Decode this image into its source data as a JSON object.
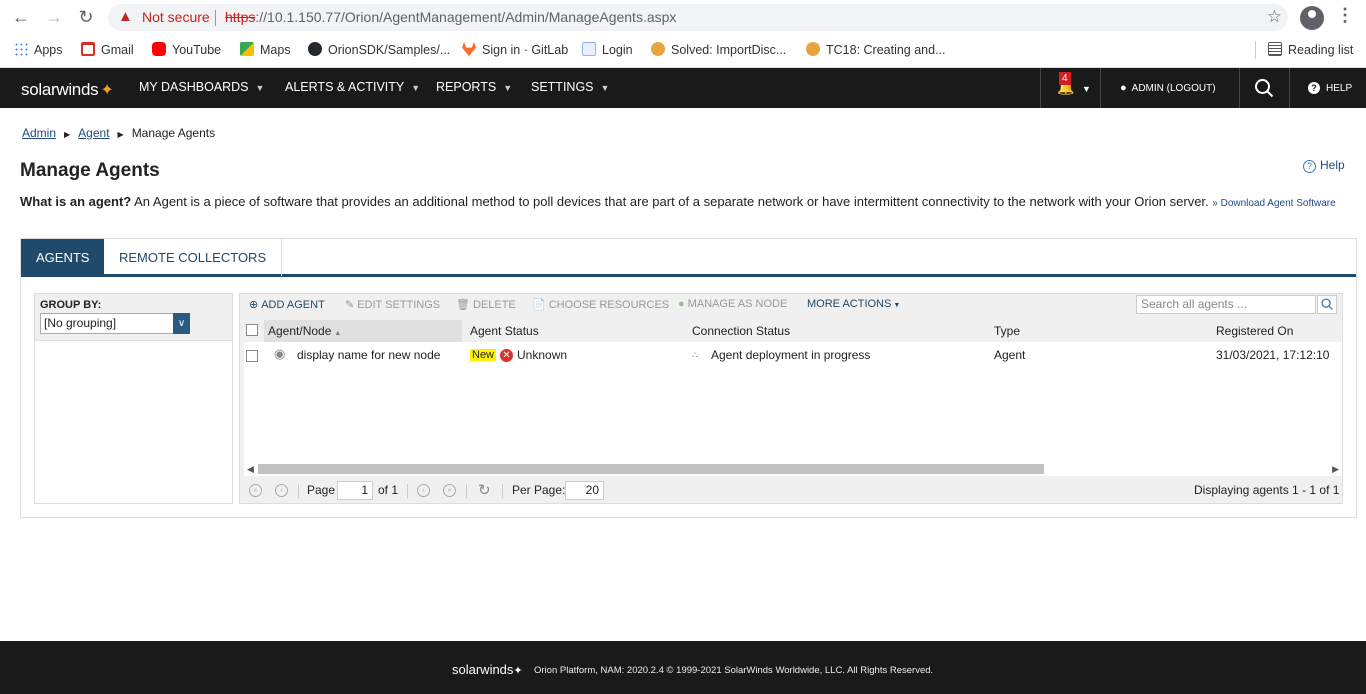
{
  "browser": {
    "not_secure": "Not secure",
    "url_scheme": "https",
    "url_rest": "://10.1.150.77/Orion/AgentManagement/Admin/ManageAgents.aspx",
    "bookmarks": [
      {
        "label": "Apps",
        "icon": "apps-icon",
        "color": "#4285f4"
      },
      {
        "label": "Gmail",
        "icon": "gmail-icon",
        "color": "#d93025"
      },
      {
        "label": "YouTube",
        "icon": "youtube-icon",
        "color": "#ff0000"
      },
      {
        "label": "Maps",
        "icon": "maps-icon",
        "color": "#34a853"
      },
      {
        "label": "OrionSDK/Samples/...",
        "icon": "github-icon",
        "color": "#24292e"
      },
      {
        "label": "Sign in · GitLab",
        "icon": "gitlab-icon",
        "color": "#fc6d26"
      },
      {
        "label": "Login",
        "icon": "page-icon",
        "color": "#8ab4f8"
      },
      {
        "label": "Solved: ImportDisc...",
        "icon": "thwack-icon",
        "color": "#e8a33d"
      },
      {
        "label": "TC18: Creating and...",
        "icon": "thwack-icon",
        "color": "#e8a33d"
      }
    ],
    "reading_list": "Reading list"
  },
  "header": {
    "logo": "solarwinds",
    "menus": [
      "MY DASHBOARDS",
      "ALERTS & ACTIVITY",
      "REPORTS",
      "SETTINGS"
    ],
    "notifications": "4",
    "user": "ADMIN (LOGOUT)",
    "help": "HELP"
  },
  "breadcrumb": {
    "admin": "Admin",
    "agent": "Agent",
    "current": "Manage Agents"
  },
  "page": {
    "title": "Manage Agents",
    "help": "Help",
    "desc_bold": "What is an agent?",
    "desc_text": " An Agent is a piece of software that provides an additional method to poll devices that are part of a separate network or have intermittent connectivity to the network with your Orion server. ",
    "download_link": "» Download Agent Software"
  },
  "tabs": {
    "agents": "AGENTS",
    "remote": "REMOTE COLLECTORS"
  },
  "groupby": {
    "label": "GROUP BY:",
    "value": "[No grouping]"
  },
  "toolbar": {
    "add": "ADD AGENT",
    "edit": "EDIT SETTINGS",
    "delete": "DELETE",
    "choose": "CHOOSE RESOURCES",
    "manage": "MANAGE AS NODE",
    "more": "MORE ACTIONS",
    "search_placeholder": "Search all agents ..."
  },
  "columns": {
    "agent": "Agent/Node",
    "status": "Agent Status",
    "connection": "Connection Status",
    "type": "Type",
    "registered": "Registered On"
  },
  "rows": [
    {
      "name": "display name for new node",
      "badge": "New",
      "status": "Unknown",
      "connection": "Agent deployment in progress",
      "type": "Agent",
      "registered": "31/03/2021, 17:12:10"
    }
  ],
  "pager": {
    "page_label": "Page",
    "page": "1",
    "of": "of 1",
    "per_page_label": "Per Page:",
    "per_page": "20",
    "displaying": "Displaying agents 1 - 1 of 1"
  },
  "footer": {
    "logo": "solarwinds",
    "copyright": "Orion Platform, NAM: 2020.2.4 © 1999-2021 SolarWinds Worldwide, LLC. All Rights Reserved."
  }
}
